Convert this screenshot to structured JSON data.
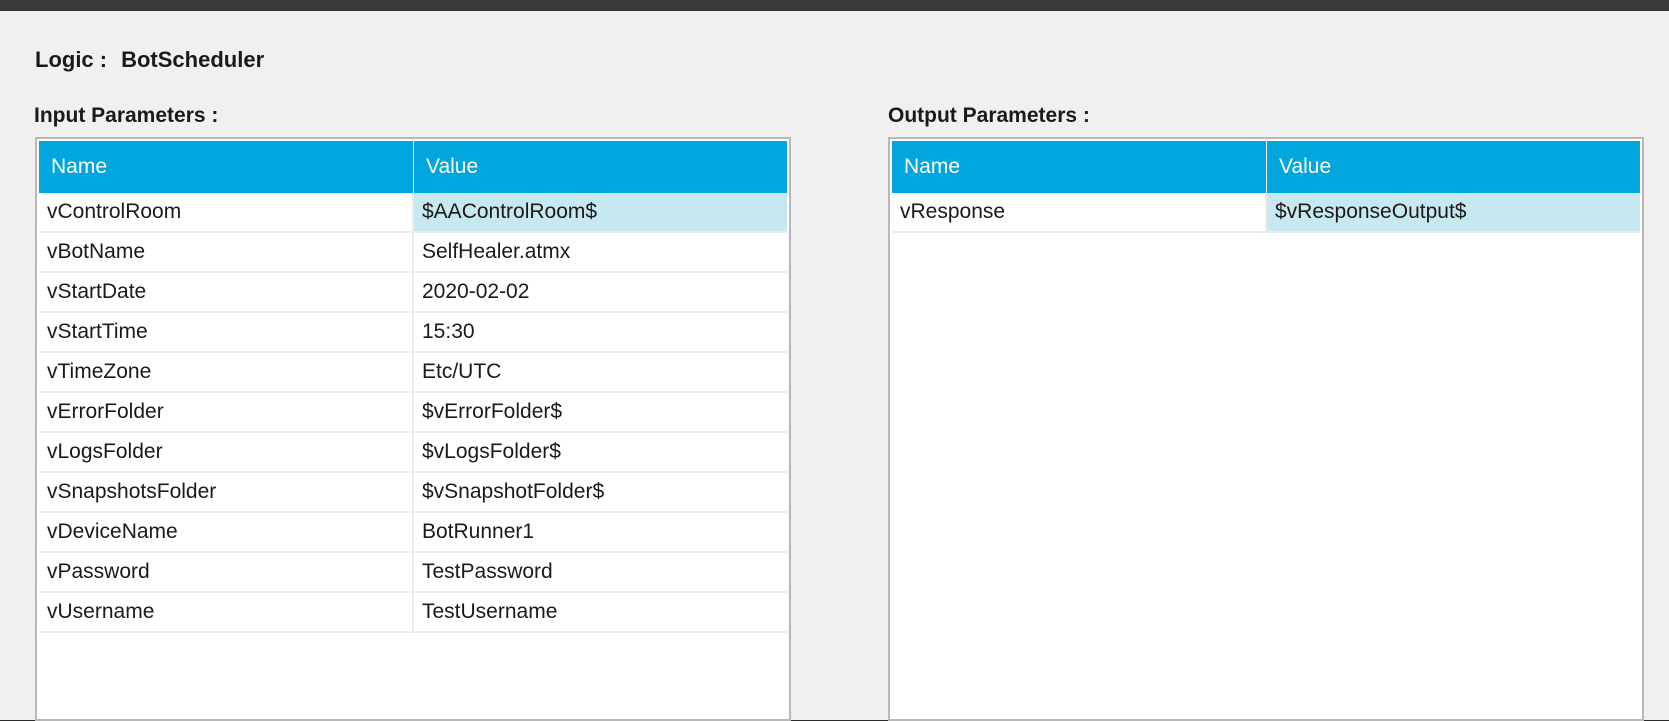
{
  "logic": {
    "label": "Logic :",
    "value": "BotScheduler"
  },
  "input_parameters": {
    "title": "Input Parameters :",
    "columns": [
      "Name",
      "Value"
    ],
    "rows": [
      {
        "name": "vControlRoom",
        "value": "$AAControlRoom$"
      },
      {
        "name": "vBotName",
        "value": "SelfHealer.atmx"
      },
      {
        "name": "vStartDate",
        "value": "2020-02-02"
      },
      {
        "name": "vStartTime",
        "value": "15:30"
      },
      {
        "name": "vTimeZone",
        "value": "Etc/UTC"
      },
      {
        "name": "vErrorFolder",
        "value": "$vErrorFolder$"
      },
      {
        "name": "vLogsFolder",
        "value": "$vLogsFolder$"
      },
      {
        "name": "vSnapshotsFolder",
        "value": "$vSnapshotFolder$"
      },
      {
        "name": "vDeviceName",
        "value": "BotRunner1"
      },
      {
        "name": "vPassword",
        "value": "TestPassword"
      },
      {
        "name": "vUsername",
        "value": "TestUsername"
      }
    ],
    "selected_row": 0
  },
  "output_parameters": {
    "title": "Output Parameters :",
    "columns": [
      "Name",
      "Value"
    ],
    "rows": [
      {
        "name": "vResponse",
        "value": "$vResponseOutput$"
      }
    ],
    "selected_row": 0
  },
  "colors": {
    "header_bg": "#00a6dd",
    "selected_cell_bg": "#c8e8f1",
    "panel_bg": "#f0f0f0"
  }
}
